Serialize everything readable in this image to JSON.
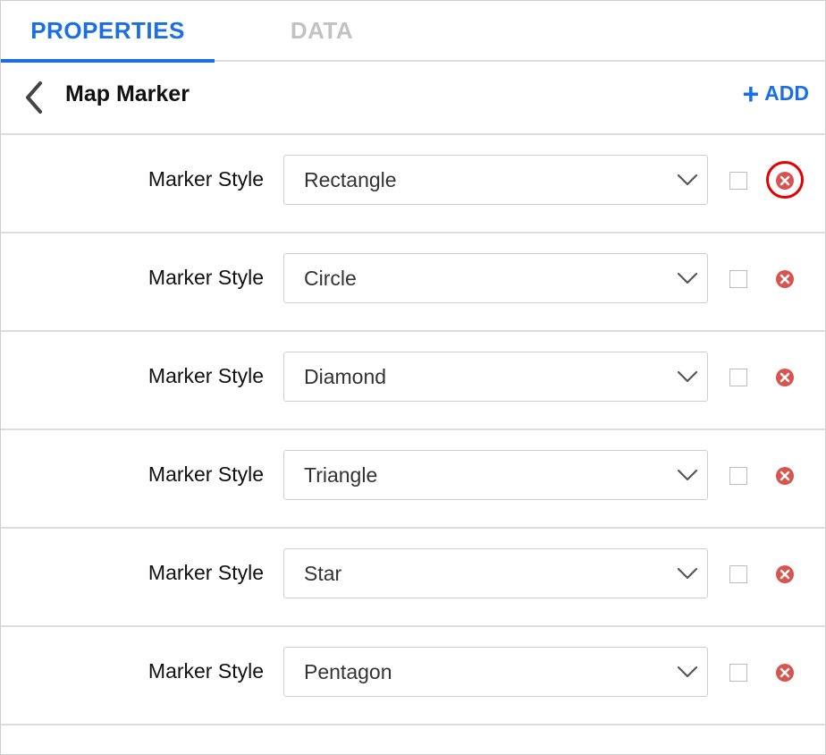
{
  "tabs": {
    "properties": "PROPERTIES",
    "data": "DATA"
  },
  "header": {
    "title": "Map Marker",
    "add_label": "ADD",
    "add_icon": "plus-icon",
    "back_icon": "chevron-left-icon"
  },
  "colors": {
    "accent": "#1a6fe6",
    "inactive_tab": "#c2c2c2",
    "remove": "#d9534f",
    "highlight": "#e60000"
  },
  "rows": [
    {
      "label": "Marker Style",
      "value": "Rectangle",
      "checked": false,
      "highlighted": true
    },
    {
      "label": "Marker Style",
      "value": "Circle",
      "checked": false,
      "highlighted": false
    },
    {
      "label": "Marker Style",
      "value": "Diamond",
      "checked": false,
      "highlighted": false
    },
    {
      "label": "Marker Style",
      "value": "Triangle",
      "checked": false,
      "highlighted": false
    },
    {
      "label": "Marker Style",
      "value": "Star",
      "checked": false,
      "highlighted": false
    },
    {
      "label": "Marker Style",
      "value": "Pentagon",
      "checked": false,
      "highlighted": false
    }
  ]
}
